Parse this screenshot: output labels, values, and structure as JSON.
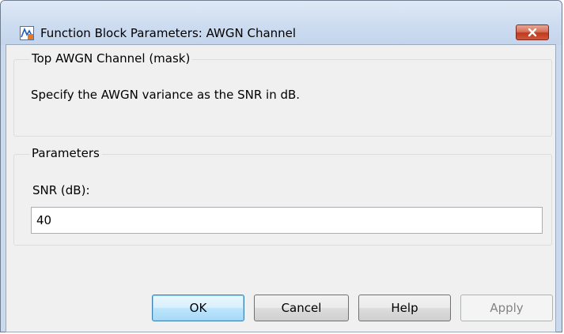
{
  "window": {
    "title": "Function Block Parameters: AWGN Channel",
    "close_icon": "close-icon"
  },
  "mask_group": {
    "legend": "Top AWGN Channel (mask)",
    "description": "Specify the AWGN variance as the SNR in dB."
  },
  "parameters_group": {
    "legend": "Parameters",
    "snr_label": "SNR (dB):",
    "snr_value": "40"
  },
  "buttons": {
    "ok": "OK",
    "cancel": "Cancel",
    "help": "Help",
    "apply": "Apply"
  },
  "colors": {
    "close_button": "#c7432a",
    "default_button_border": "#3c7fb1",
    "disabled_text": "#838383"
  }
}
